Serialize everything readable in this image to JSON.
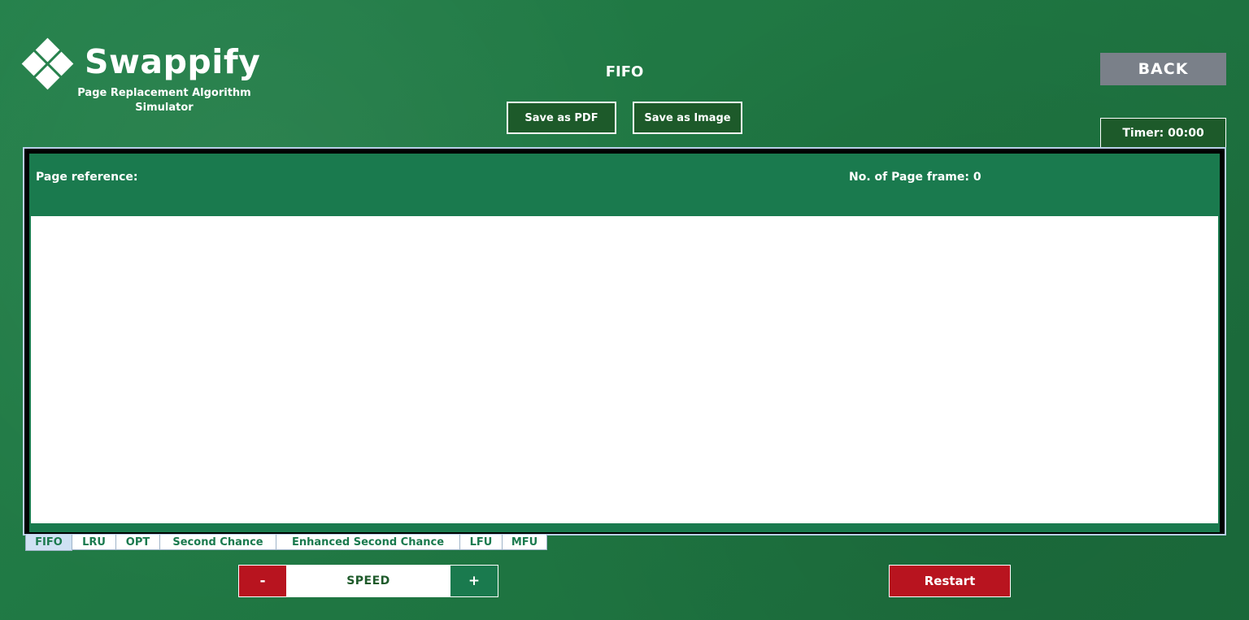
{
  "app": {
    "name": "Swappify",
    "subtitle": "Page Replacement Algorithm Simulator"
  },
  "header": {
    "algorithm": "FIFO",
    "save_pdf_label": "Save as PDF",
    "save_image_label": "Save as Image",
    "back_label": "BACK",
    "timer": "Timer: 00:00"
  },
  "panel": {
    "page_reference_label": "Page reference:",
    "frame_count_label": "No. of Page frame: 0"
  },
  "tabs": [
    {
      "label": "FIFO",
      "active": true
    },
    {
      "label": "LRU",
      "active": false
    },
    {
      "label": "OPT",
      "active": false
    },
    {
      "label": "Second Chance",
      "active": false
    },
    {
      "label": "Enhanced Second Chance",
      "active": false
    },
    {
      "label": "LFU",
      "active": false
    },
    {
      "label": "MFU",
      "active": false
    }
  ],
  "controls": {
    "speed_minus": "-",
    "speed_label": "SPEED",
    "speed_plus": "+",
    "restart_label": "Restart"
  },
  "colors": {
    "background": "#217a45",
    "panel_green": "#1a7a4e",
    "button_dark_green": "#1d5a2a",
    "back_gray": "#7a8089",
    "danger_red": "#b8141f",
    "active_tab": "#cfe1f3"
  },
  "icons": {
    "logo": "four-diamonds-logo-icon"
  }
}
